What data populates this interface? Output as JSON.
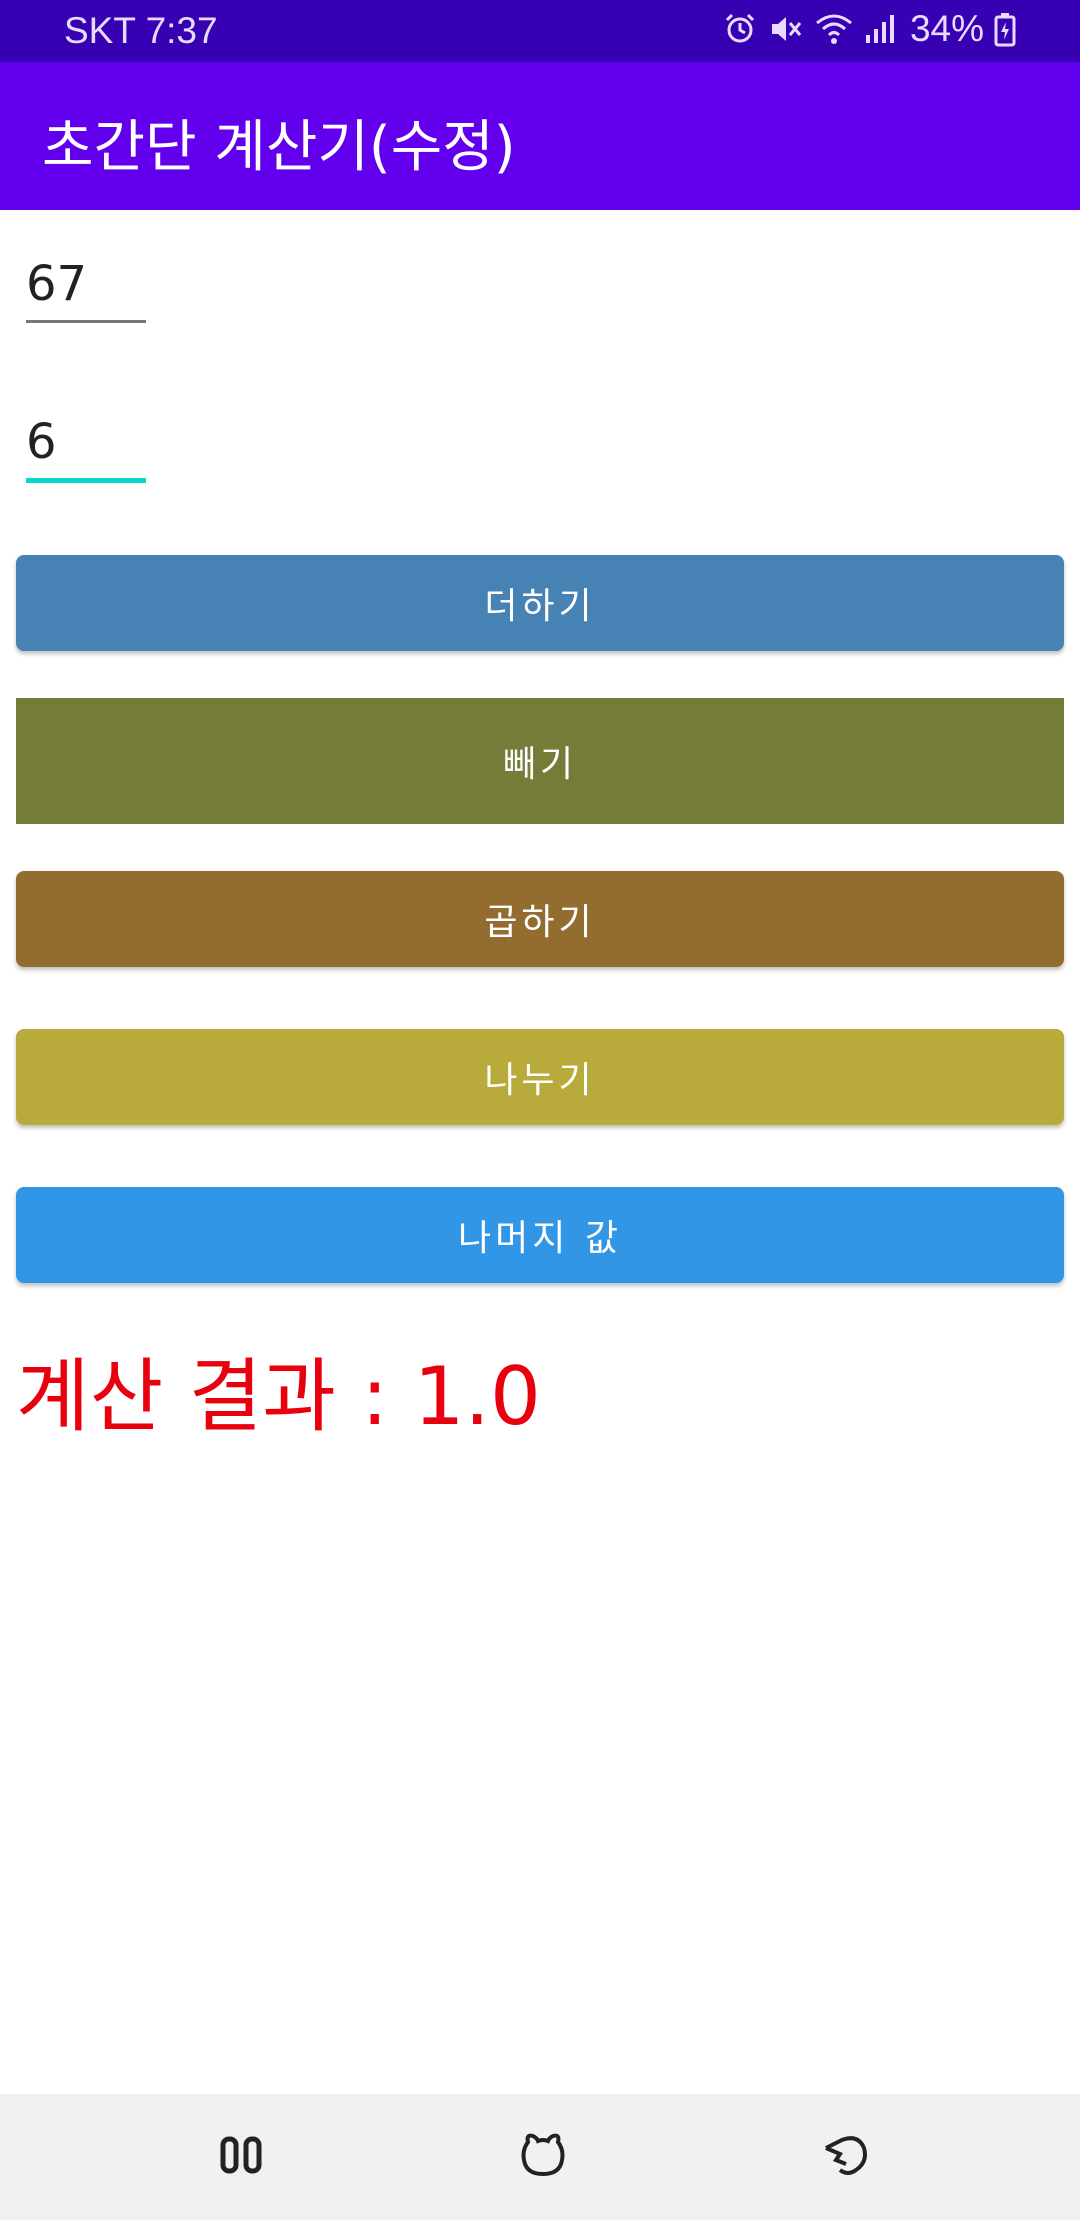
{
  "status_bar": {
    "carrier_time": "SKT 7:37",
    "battery": "34%",
    "icons": [
      "alarm-icon",
      "mute-icon",
      "wifi-icon",
      "signal-icon",
      "battery-charging-icon"
    ]
  },
  "app_bar": {
    "title": "초간단 계산기(수정)"
  },
  "inputs": {
    "first_value": "67",
    "second_value": "6"
  },
  "buttons": {
    "add": "더하기",
    "subtract": "빼기",
    "multiply": "곱하기",
    "divide": "나누기",
    "remainder": "나머지 값"
  },
  "result": {
    "text": "계산 결과 : 1.0"
  },
  "colors": {
    "status_bar": "#3700b3",
    "app_bar": "#6200ee",
    "add_button": "#4682b4",
    "subtract_button": "#757c38",
    "multiply_button": "#936d30",
    "divide_button": "#b8ab3b",
    "remainder_button": "#3296e7",
    "result_text": "#e8000e",
    "input_focus_underline": "#03dac5"
  },
  "nav_bar": {
    "icons": [
      "recents-icon",
      "home-icon",
      "back-icon"
    ]
  }
}
